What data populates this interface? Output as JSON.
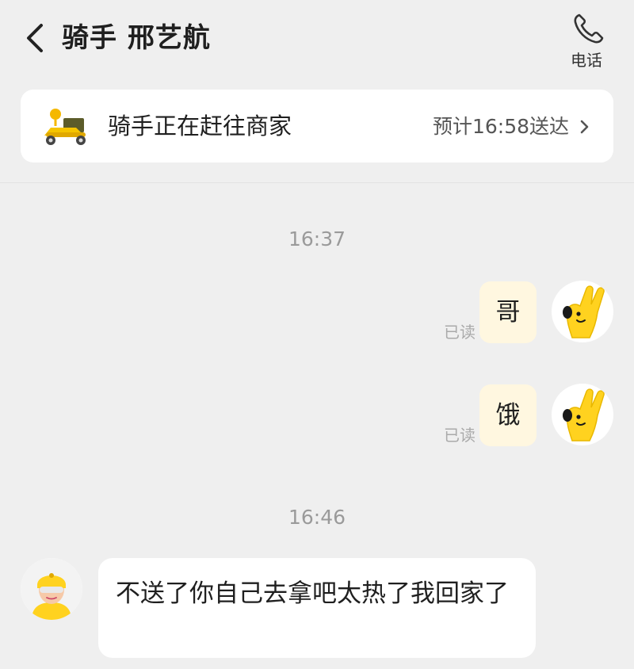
{
  "header": {
    "title": "骑手 邢艺航",
    "back_icon": "chevron-left-icon",
    "phone_icon": "phone-icon",
    "phone_label": "电话"
  },
  "status_card": {
    "icon": "rider-scooter-icon",
    "status": "骑手正在赶往商家",
    "eta": "预计16:58送达",
    "chevron_icon": "chevron-right-icon"
  },
  "chat": {
    "timestamps": [
      "16:37",
      "16:46"
    ],
    "messages": [
      {
        "from": "me",
        "text": "哥",
        "read": "已读"
      },
      {
        "from": "me",
        "text": "饿",
        "read": "已读"
      },
      {
        "from": "rider",
        "text": "不送了你自己去拿吧太热了我回家了"
      }
    ]
  },
  "colors": {
    "background": "#efefef",
    "outgoing_bubble": "#fff7e0",
    "incoming_bubble": "#ffffff",
    "accent_yellow": "#ffd21f"
  }
}
